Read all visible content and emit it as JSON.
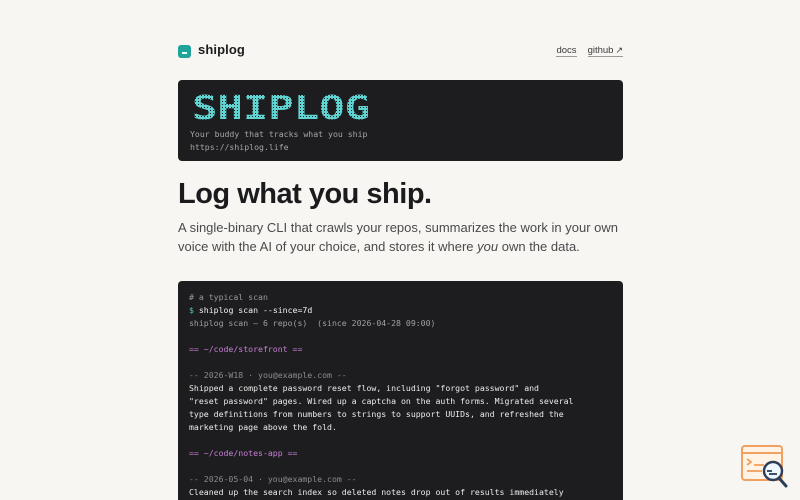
{
  "header": {
    "brand": "shiplog",
    "nav": [
      {
        "label": "docs"
      },
      {
        "label": "github",
        "icon": "arrow-up-right-icon"
      }
    ]
  },
  "banner": {
    "ascii_logo": "SHIPLOG",
    "tagline": "Your buddy that tracks what you ship",
    "url": "https://shiplog.life"
  },
  "hero": {
    "title": "Log what you ship.",
    "subtitle_before": "A single-binary CLI that crawls your repos, summarizes the work in your own voice with the AI of your choice, and stores it where ",
    "subtitle_em": "you",
    "subtitle_after": " own the data."
  },
  "terminal": {
    "comment": "# a typical scan",
    "prompt": "$",
    "command": "shiplog scan --since=7d",
    "summary": "shiplog scan — 6 repo(s)  (since 2026-04-28 09:00)",
    "repo1": "== ~/code/storefront ==",
    "entry1_meta": "-- 2026-W18 · you@example.com --",
    "entry1_lines": [
      "Shipped a complete password reset flow, including \"forgot password\" and",
      "\"reset password\" pages. Wired up a captcha on the auth forms. Migrated several",
      "type definitions from numbers to strings to support UUIDs, and refreshed the",
      "marketing page above the fold."
    ],
    "repo2": "== ~/code/notes-app ==",
    "entry2_meta": "-- 2026-05-04 · you@example.com --",
    "entry2_lines": [
      "Cleaned up the search index so deleted notes drop out of results immediately"
    ]
  },
  "widget": {
    "icon": "search-document-icon"
  },
  "colors": {
    "accent": "#1fa39a",
    "banner_logo": "#5fd4d2",
    "repo_heading": "#c87fd8",
    "background": "#f7f6f2",
    "terminal_bg": "#1d1d1f",
    "widget_orange": "#f0a060"
  }
}
